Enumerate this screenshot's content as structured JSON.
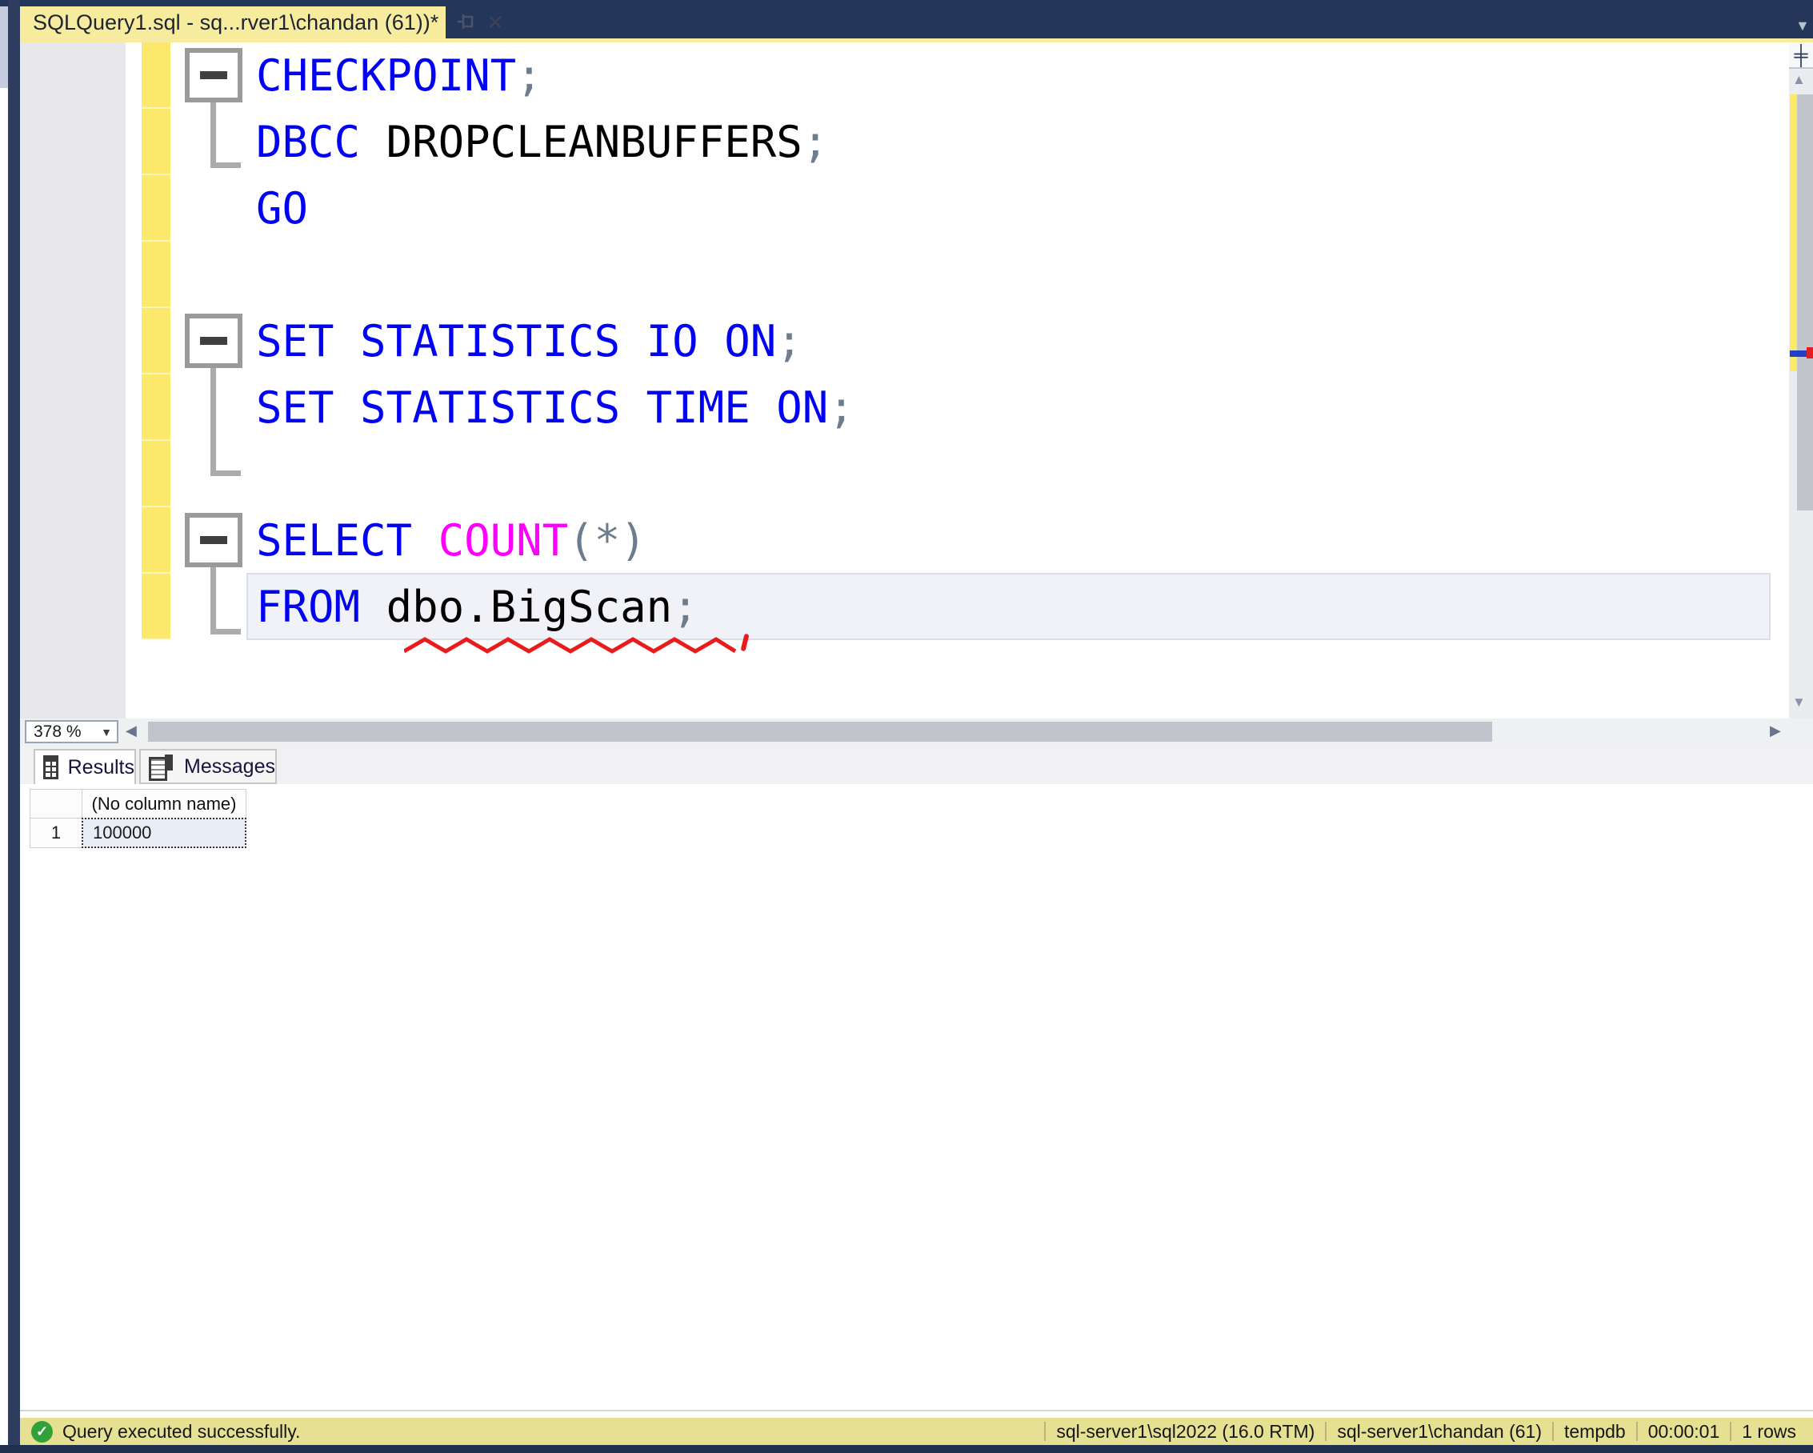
{
  "window": {
    "tab_title": "SQLQuery1.sql - sq...rver1\\chandan (61))*"
  },
  "editor": {
    "zoom_value": "378 %",
    "lines": [
      {
        "segs": [
          {
            "t": "CHECKPOINT",
            "c": "kw"
          },
          {
            "t": ";",
            "c": "op"
          }
        ]
      },
      {
        "segs": [
          {
            "t": "DBCC",
            "c": "kw"
          },
          {
            "t": " ",
            "c": "pl"
          },
          {
            "t": "DROPCLEANBUFFERS",
            "c": "pl"
          },
          {
            "t": ";",
            "c": "op"
          }
        ]
      },
      {
        "segs": [
          {
            "t": "GO",
            "c": "kw"
          }
        ]
      },
      {
        "segs": []
      },
      {
        "segs": [
          {
            "t": "SET STATISTICS IO ON",
            "c": "kw"
          },
          {
            "t": ";",
            "c": "op"
          }
        ]
      },
      {
        "segs": [
          {
            "t": "SET STATISTICS TIME ON",
            "c": "kw"
          },
          {
            "t": ";",
            "c": "op"
          }
        ]
      },
      {
        "segs": []
      },
      {
        "segs": [
          {
            "t": "SELECT",
            "c": "kw"
          },
          {
            "t": " ",
            "c": "pl"
          },
          {
            "t": "COUNT",
            "c": "fn"
          },
          {
            "t": "(*)",
            "c": "op"
          }
        ]
      },
      {
        "segs": [
          {
            "t": "FROM",
            "c": "kw"
          },
          {
            "t": " ",
            "c": "pl"
          },
          {
            "t": "dbo.BigScan",
            "c": "pl"
          },
          {
            "t": ";",
            "c": "op"
          }
        ],
        "highlight": true
      }
    ],
    "error_squiggle_under": "dbo.BigScan"
  },
  "results": {
    "tabs": [
      {
        "label": "Results",
        "active": true
      },
      {
        "label": "Messages",
        "active": false
      }
    ],
    "grid": {
      "col_header": "(No column name)",
      "rows": [
        {
          "num": "1",
          "value": "100000"
        }
      ]
    }
  },
  "status": {
    "message": "Query executed successfully.",
    "check_label": "✓",
    "segments": [
      "sql-server1\\sql2022 (16.0 RTM)",
      "sql-server1\\chandan (61)",
      "tempdb",
      "00:00:01",
      "1 rows"
    ]
  },
  "glyphs": {
    "close": "✕",
    "splitter": "╪",
    "up_arrow": "▲",
    "down_arrow": "▼",
    "left_arrow": "◀",
    "right_arrow": "▶",
    "dropdown": "▼"
  },
  "colors": {
    "keyword_blue": "#0202f2",
    "function_magenta": "#ff00ff",
    "operator_gray": "#6d7d8d",
    "tab_yellow": "#f7ec9e",
    "change_bar_yellow": "#fce96b",
    "status_khaki": "#e6e092",
    "title_navy": "#24365a",
    "success_green": "#33a13a",
    "error_red": "#e81c1c"
  }
}
